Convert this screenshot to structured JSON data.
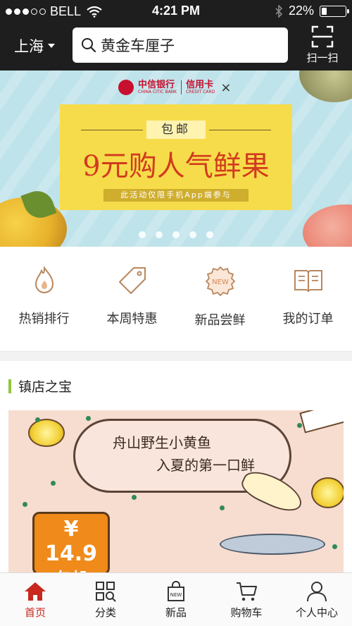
{
  "status_bar": {
    "carrier": "BELL",
    "time": "4:21 PM",
    "battery": "22%",
    "battery_level": 0.22
  },
  "header": {
    "city": "上海",
    "search_value": "黄金车厘子",
    "scan_label": "扫一扫"
  },
  "banner": {
    "bank_name": "中信银行",
    "bank_name_en": "CHINA CITIC BANK",
    "card_label": "信用卡",
    "card_label_en": "CREDIT CARD",
    "close_mark": "×",
    "tag": "包邮",
    "title": "9元购人气鲜果",
    "note": "此活动仅限手机App端参与",
    "page_count": 5,
    "active_page": 1
  },
  "categories": [
    {
      "label": "热销排行",
      "icon": "flame-icon"
    },
    {
      "label": "本周特惠",
      "icon": "price-tag-icon"
    },
    {
      "label": "新品尝鲜",
      "icon": "new-badge-icon"
    },
    {
      "label": "我的订单",
      "icon": "book-icon"
    }
  ],
  "section": {
    "title": "镇店之宝",
    "accent": "#8ec63f"
  },
  "promo": {
    "line1": "舟山野生小黄鱼",
    "line2": "入夏的第一口鲜",
    "price": "¥ 14.9",
    "price_note": "包邮"
  },
  "tabbar": {
    "active_color": "#c8281e",
    "items": [
      {
        "label": "首页",
        "icon": "home-icon"
      },
      {
        "label": "分类",
        "icon": "category-grid-icon"
      },
      {
        "label": "新品",
        "icon": "new-bag-icon"
      },
      {
        "label": "购物车",
        "icon": "cart-icon"
      },
      {
        "label": "个人中心",
        "icon": "user-icon"
      }
    ]
  }
}
